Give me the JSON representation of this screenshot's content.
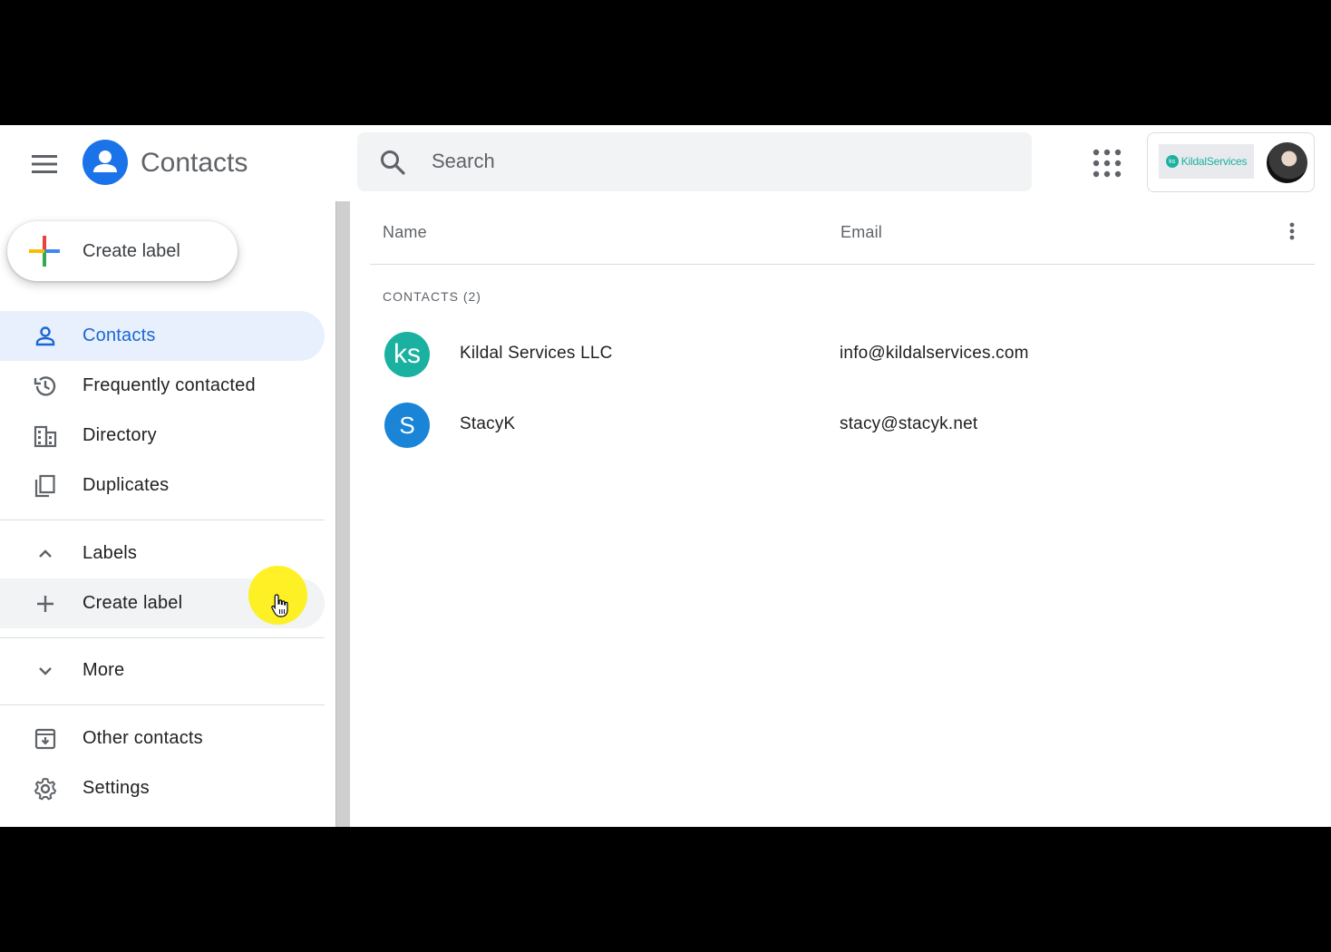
{
  "header": {
    "app_title": "Contacts",
    "search_placeholder": "Search",
    "org_logo_text": "KildalServices",
    "org_logo_mark": "ks",
    "brand_color": "#1a73e8"
  },
  "sidebar": {
    "create_label": "Create label",
    "items": [
      {
        "label": "Contacts",
        "icon": "person-icon",
        "active": true
      },
      {
        "label": "Frequently contacted",
        "icon": "history-icon"
      },
      {
        "label": "Directory",
        "icon": "building-icon"
      },
      {
        "label": "Duplicates",
        "icon": "copy-icon"
      }
    ],
    "labels_header": "Labels",
    "more_label": "More",
    "other_contacts": "Other contacts",
    "settings": "Settings"
  },
  "list": {
    "columns": {
      "name": "Name",
      "email": "Email"
    },
    "section_title": "CONTACTS (2)",
    "contacts": [
      {
        "name": "Kildal Services LLC",
        "email": "info@kildalservices.com",
        "initials": "ks",
        "color": "#1ab1a1"
      },
      {
        "name": "StacyK",
        "email": "stacy@stacyk.net",
        "initials": "S",
        "color": "#1a85d6"
      }
    ]
  },
  "colors": {
    "active_bg": "#e8f0fe",
    "active_text": "#1967d2",
    "cursor_highlight": "#ffee00"
  }
}
